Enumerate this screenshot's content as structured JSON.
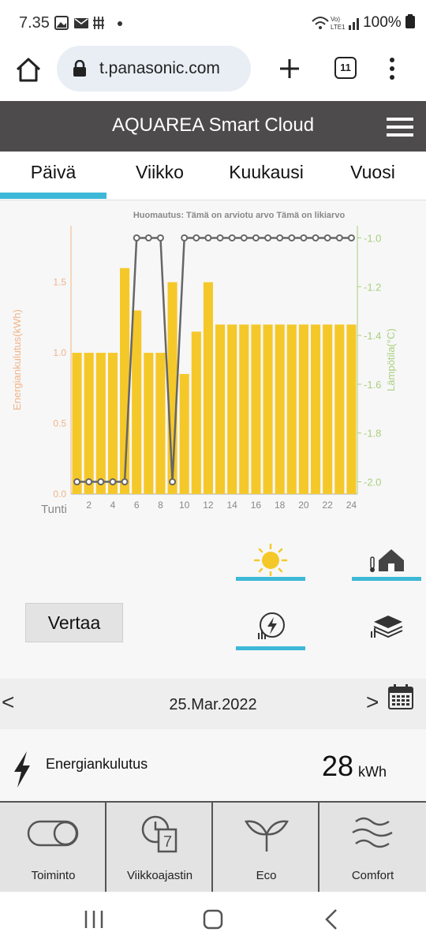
{
  "statusbar": {
    "time": "7.35",
    "battery": "100%"
  },
  "browser": {
    "url": "t.panasonic.com",
    "tab_count": "11"
  },
  "app": {
    "title": "AQUAREA Smart Cloud"
  },
  "tabs": [
    {
      "label": "Päivä",
      "active": true
    },
    {
      "label": "Viikko",
      "active": false
    },
    {
      "label": "Kuukausi",
      "active": false
    },
    {
      "label": "Vuosi",
      "active": false
    }
  ],
  "chart_data": {
    "type": "bar",
    "note": "Huomautus: Tämä on arviotu arvo Tämä on likiarvo",
    "xlabel": "Tunti",
    "ylabel_left": "Energiankulutus(kWh)",
    "ylabel_right": "Lämpötila(°C)",
    "x": [
      1,
      2,
      3,
      4,
      5,
      6,
      7,
      8,
      9,
      10,
      11,
      12,
      13,
      14,
      15,
      16,
      17,
      18,
      19,
      20,
      21,
      22,
      23,
      24
    ],
    "x_ticks": [
      2,
      4,
      6,
      8,
      10,
      12,
      14,
      16,
      18,
      20,
      22,
      24
    ],
    "ylim_left": [
      0,
      1.9
    ],
    "ylim_right": [
      -2.05,
      -0.95
    ],
    "yticks_left": [
      0.0,
      0.5,
      1.0,
      1.5
    ],
    "yticks_left_labels": [
      "0.0",
      "0.5",
      "1.0",
      "1.5"
    ],
    "yticks_right": [
      -2.0,
      -1.8,
      -1.6,
      -1.4,
      -1.2,
      -1.0
    ],
    "yticks_right_labels": [
      "-2.0",
      "-1.8",
      "-1.6",
      "-1.4",
      "-1.2",
      "-1.0"
    ],
    "series": [
      {
        "type": "bar",
        "color": "#f5c82a",
        "values": [
          1.0,
          1.0,
          1.0,
          1.0,
          1.6,
          1.3,
          1.0,
          1.0,
          1.5,
          0.85,
          1.15,
          1.5,
          1.2,
          1.2,
          1.2,
          1.2,
          1.2,
          1.2,
          1.2,
          1.2,
          1.2,
          1.2,
          1.2,
          1.2
        ]
      },
      {
        "type": "line",
        "axis": "right",
        "color": "#666666",
        "values": [
          -2.0,
          -2.0,
          -2.0,
          -2.0,
          -2.0,
          -1.0,
          -1.0,
          -1.0,
          -2.0,
          -1.0,
          -1.0,
          -1.0,
          -1.0,
          -1.0,
          -1.0,
          -1.0,
          -1.0,
          -1.0,
          -1.0,
          -1.0,
          -1.0,
          -1.0,
          -1.0,
          -1.0
        ]
      }
    ]
  },
  "controls": {
    "compare_label": "Vertaa",
    "modes": [
      {
        "icon": "sun-icon",
        "selected": true
      },
      {
        "icon": "house-temperature-icon",
        "selected": true
      },
      {
        "icon": "energy-meter-icon",
        "selected": true
      },
      {
        "icon": "layers-icon",
        "selected": false
      }
    ]
  },
  "date": {
    "prev": "<",
    "next": ">",
    "value": "25.Mar.2022"
  },
  "energy": {
    "label": "Energiankulutus",
    "value": "28",
    "unit": "kWh"
  },
  "bottom_nav": [
    {
      "label": "Toiminto",
      "icon": "toggle-icon"
    },
    {
      "label": "Viikkoajastin",
      "icon": "weekly-timer-icon"
    },
    {
      "label": "Eco",
      "icon": "leaf-icon"
    },
    {
      "label": "Comfort",
      "icon": "waves-icon"
    }
  ],
  "colors": {
    "accent": "#3db8d8",
    "header": "#4d4b4b",
    "bar": "#f5c82a",
    "left_axis": "#f0b48a",
    "right_axis": "#a9cf7e"
  }
}
